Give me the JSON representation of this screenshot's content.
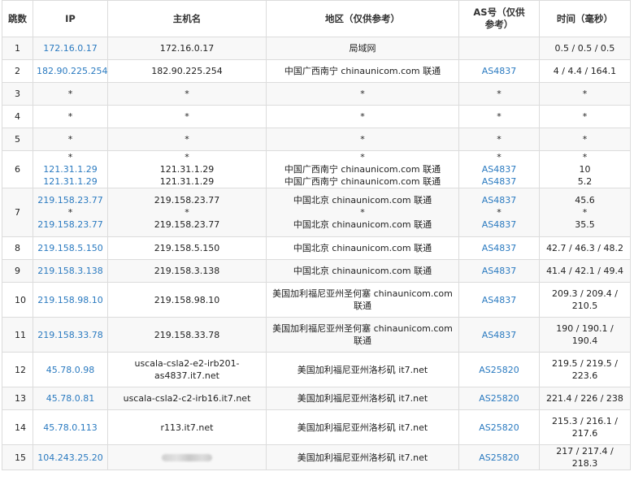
{
  "headers": {
    "hop": "跳数",
    "ip": "IP",
    "host": "主机名",
    "region": "地区（仅供参考）",
    "as": "AS号（仅供参考）",
    "time": "时间（毫秒）"
  },
  "rows": [
    {
      "hop": "1",
      "ip": [
        "172.16.0.17"
      ],
      "host": [
        "172.16.0.17"
      ],
      "region": [
        "局域网"
      ],
      "as": [
        ""
      ],
      "time": [
        "0.5 / 0.5 / 0.5"
      ]
    },
    {
      "hop": "2",
      "ip": [
        "182.90.225.254"
      ],
      "host": [
        "182.90.225.254"
      ],
      "region": [
        "中国广西南宁 chinaunicom.com 联通"
      ],
      "as": [
        "AS4837"
      ],
      "time": [
        "4 / 4.4 / 164.1"
      ]
    },
    {
      "hop": "3",
      "ip": [
        "*"
      ],
      "host": [
        "*"
      ],
      "region": [
        "*"
      ],
      "as": [
        "*"
      ],
      "time": [
        "*"
      ]
    },
    {
      "hop": "4",
      "ip": [
        "*"
      ],
      "host": [
        "*"
      ],
      "region": [
        "*"
      ],
      "as": [
        "*"
      ],
      "time": [
        "*"
      ]
    },
    {
      "hop": "5",
      "ip": [
        "*"
      ],
      "host": [
        "*"
      ],
      "region": [
        "*"
      ],
      "as": [
        "*"
      ],
      "time": [
        "*"
      ]
    },
    {
      "hop": "6",
      "ip": [
        "*",
        "121.31.1.29",
        "121.31.1.29"
      ],
      "host": [
        "*",
        "121.31.1.29",
        "121.31.1.29"
      ],
      "region": [
        "*",
        "中国广西南宁 chinaunicom.com 联通",
        "中国广西南宁 chinaunicom.com 联通"
      ],
      "as": [
        "*",
        "AS4837",
        "AS4837"
      ],
      "time": [
        "*",
        "10",
        "5.2"
      ]
    },
    {
      "hop": "7",
      "ip": [
        "219.158.23.77",
        "*",
        "219.158.23.77"
      ],
      "host": [
        "219.158.23.77",
        "*",
        "219.158.23.77"
      ],
      "region": [
        "中国北京 chinaunicom.com 联通",
        "*",
        "中国北京 chinaunicom.com 联通"
      ],
      "as": [
        "AS4837",
        "*",
        "AS4837"
      ],
      "time": [
        "45.6",
        "*",
        "35.5"
      ]
    },
    {
      "hop": "8",
      "ip": [
        "219.158.5.150"
      ],
      "host": [
        "219.158.5.150"
      ],
      "region": [
        "中国北京 chinaunicom.com 联通"
      ],
      "as": [
        "AS4837"
      ],
      "time": [
        "42.7 / 46.3 / 48.2"
      ]
    },
    {
      "hop": "9",
      "ip": [
        "219.158.3.138"
      ],
      "host": [
        "219.158.3.138"
      ],
      "region": [
        "中国北京 chinaunicom.com 联通"
      ],
      "as": [
        "AS4837"
      ],
      "time": [
        "41.4 / 42.1 / 49.4"
      ]
    },
    {
      "hop": "10",
      "ip": [
        "219.158.98.10"
      ],
      "host": [
        "219.158.98.10"
      ],
      "region": [
        "美国加利福尼亚州圣何塞 chinaunicom.com 联通"
      ],
      "as": [
        "AS4837"
      ],
      "time": [
        "209.3 / 209.4 / 210.5"
      ]
    },
    {
      "hop": "11",
      "ip": [
        "219.158.33.78"
      ],
      "host": [
        "219.158.33.78"
      ],
      "region": [
        "美国加利福尼亚州圣何塞 chinaunicom.com 联通"
      ],
      "as": [
        "AS4837"
      ],
      "time": [
        "190 / 190.1 / 190.4"
      ]
    },
    {
      "hop": "12",
      "ip": [
        "45.78.0.98"
      ],
      "host": [
        "uscala-csla2-e2-irb201-as4837.it7.net"
      ],
      "region": [
        "美国加利福尼亚州洛杉矶 it7.net"
      ],
      "as": [
        "AS25820"
      ],
      "time": [
        "219.5 / 219.5 / 223.6"
      ]
    },
    {
      "hop": "13",
      "ip": [
        "45.78.0.81"
      ],
      "host": [
        "uscala-csla2-c2-irb16.it7.net"
      ],
      "region": [
        "美国加利福尼亚州洛杉矶 it7.net"
      ],
      "as": [
        "AS25820"
      ],
      "time": [
        "221.4 / 226 / 238"
      ]
    },
    {
      "hop": "14",
      "ip": [
        "45.78.0.113"
      ],
      "host": [
        "r113.it7.net"
      ],
      "region": [
        "美国加利福尼亚州洛杉矶 it7.net"
      ],
      "as": [
        "AS25820"
      ],
      "time": [
        "215.3 / 216.1 / 217.6"
      ]
    },
    {
      "hop": "15",
      "ip": [
        "104.243.25.20"
      ],
      "host": [
        "[blurred]"
      ],
      "region": [
        "美国加利福尼亚州洛杉矶 it7.net"
      ],
      "as": [
        "AS25820"
      ],
      "time": [
        "217 / 217.4 / 218.3"
      ]
    }
  ]
}
